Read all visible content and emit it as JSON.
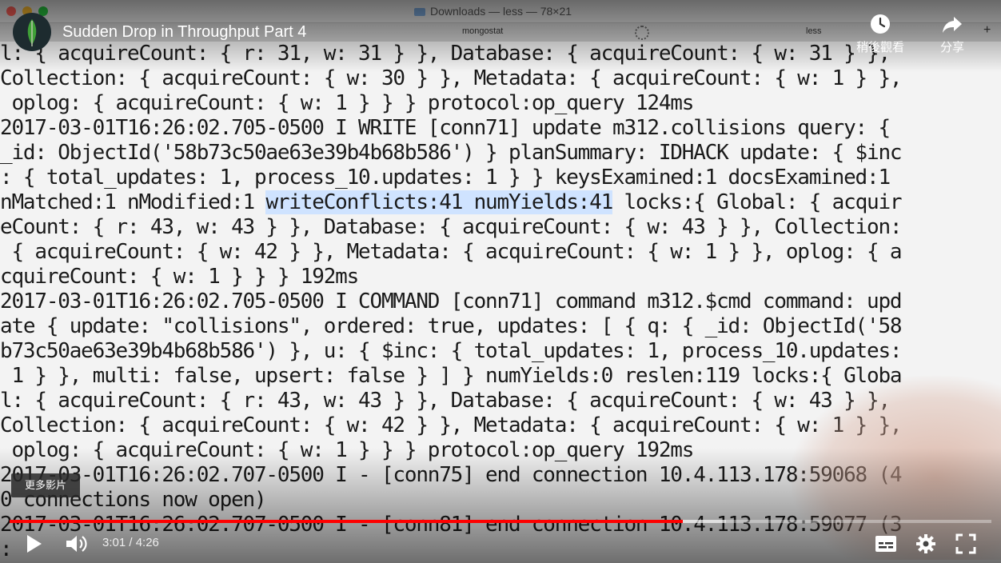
{
  "window": {
    "title": "Downloads — less — 78×21",
    "tabs": [
      "mongostat",
      "less"
    ],
    "new_tab": "+"
  },
  "video": {
    "title": "Sudden Drop in Throughput Part 4",
    "watch_later_label": "稍後觀看",
    "share_label": "分享",
    "more_videos_label": "更多影片",
    "time_display": "3:01 / 4:26",
    "progress_played": 0.686,
    "progress_buffered": 0.73
  },
  "terminal": {
    "lines": [
      "l: { acquireCount: { r: 31, w: 31 } }, Database: { acquireCount: { w: 31 } },",
      "Collection: { acquireCount: { w: 30 } }, Metadata: { acquireCount: { w: 1 } },",
      " oplog: { acquireCount: { w: 1 } } } protocol:op_query 124ms",
      "2017-03-01T16:26:02.705-0500 I WRITE [conn71] update m312.collisions query: {",
      "_id: ObjectId('58b73c50ae63e39b4b68b586') } planSummary: IDHACK update: { $inc",
      ": { total_updates: 1, process_10.updates: 1 } } keysExamined:1 docsExamined:1",
      "nMatched:1 nModified:1 writeConflicts:41 numYields:41 locks:{ Global: { acquir",
      "eCount: { r: 43, w: 43 } }, Database: { acquireCount: { w: 43 } }, Collection:",
      " { acquireCount: { w: 42 } }, Metadata: { acquireCount: { w: 1 } }, oplog: { a",
      "cquireCount: { w: 1 } } } 192ms",
      "2017-03-01T16:26:02.705-0500 I COMMAND [conn71] command m312.$cmd command: upd",
      "ate { update: \"collisions\", ordered: true, updates: [ { q: { _id: ObjectId('58",
      "b73c50ae63e39b4b68b586') }, u: { $inc: { total_updates: 1, process_10.updates:",
      " 1 } }, multi: false, upsert: false } ] } numYields:0 reslen:119 locks:{ Globa",
      "l: { acquireCount: { r: 43, w: 43 } }, Database: { acquireCount: { w: 43 } },",
      "Collection: { acquireCount: { w: 42 } }, Metadata: { acquireCount: { w: 1 } },",
      " oplog: { acquireCount: { w: 1 } } } protocol:op_query 192ms",
      "2017-03-01T16:26:02.707-0500 I - [conn75] end connection 10.4.113.178:59068 (4",
      "0 connections now open)",
      "2017-03-01T16:26:02.707-0500 I - [conn81] end connection 10.4.113.178:59077 (3",
      ":"
    ],
    "highlight_line_index": 6,
    "line_6_before": "nMatched:1 nModified:1 ",
    "line_6_highlight": "writeConflicts:41 numYields:41",
    "line_6_after": " locks:{ Global: { acquir"
  },
  "colors": {
    "progress_red": "#ff0000",
    "highlight": "#cfe3ff",
    "terminal_text": "#1a1a1a"
  }
}
